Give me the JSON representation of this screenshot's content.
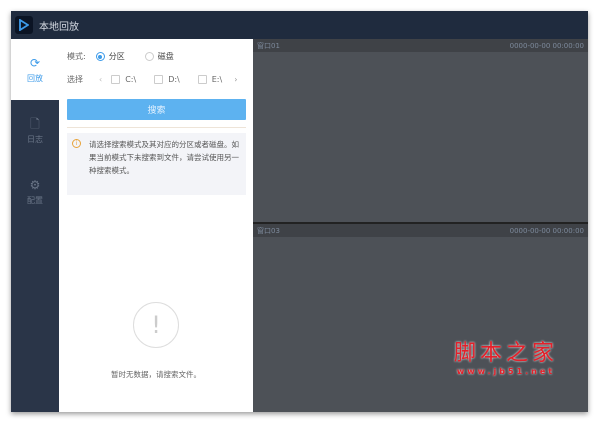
{
  "window": {
    "title": "本地回放"
  },
  "sidebar": {
    "items": [
      {
        "label": "回放",
        "icon": "refresh-icon",
        "active": true
      },
      {
        "label": "日志",
        "icon": "file-icon"
      },
      {
        "label": "配置",
        "icon": "gear-icon"
      }
    ]
  },
  "search": {
    "mode_label": "模式:",
    "modes": [
      {
        "label": "分区",
        "selected": true
      },
      {
        "label": "磁盘",
        "selected": false
      }
    ],
    "select_label": "选择",
    "drives": [
      "C:\\",
      "D:\\",
      "E:\\"
    ],
    "search_button": "搜索",
    "tip": "请选择搜索模式及其对应的分区或者磁盘。如果当前模式下未搜索到文件，请尝试使用另一种搜索模式。",
    "empty_text": "暂时无数据，请搜索文件。"
  },
  "video": {
    "panes": [
      {
        "name": "窗口01",
        "time": "0000-00-00 00:00:00"
      },
      {
        "name": "窗口03",
        "time": "0000-00-00 00:00:00"
      }
    ]
  },
  "watermark": {
    "text": "脚本之家",
    "url": "www.jb51.net"
  },
  "colors": {
    "accent": "#3d9be9",
    "button": "#5db2f0",
    "titlebar": "#1f2b3e",
    "video_bg": "#4d5157"
  }
}
